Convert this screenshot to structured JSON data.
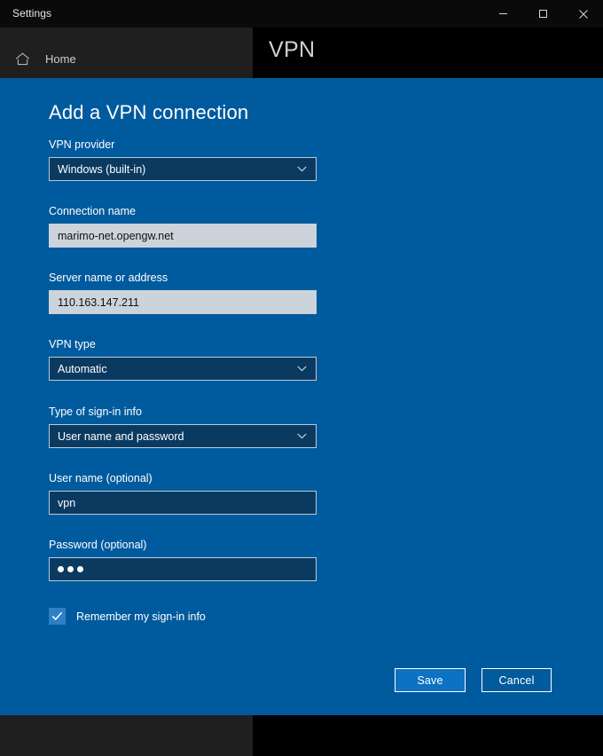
{
  "window": {
    "title": "Settings",
    "controls": [
      {
        "name": "minimize",
        "glyph": "minimize-icon"
      },
      {
        "name": "maximize",
        "glyph": "maximize-icon"
      },
      {
        "name": "close",
        "glyph": "close-icon"
      }
    ]
  },
  "sidebar": {
    "home_label": "Home",
    "home_icon": "home-icon"
  },
  "page": {
    "header": "VPN"
  },
  "dialog": {
    "title": "Add a VPN connection",
    "fields": [
      {
        "label": "VPN provider",
        "value": "Windows (built-in)",
        "type": "dropdown",
        "name": "vpn-provider"
      },
      {
        "label": "Connection name",
        "value": "marimo-net.opengw.net",
        "type": "text-filled",
        "name": "connection-name"
      },
      {
        "label": "Server name or address",
        "value": "110.163.147.211",
        "type": "text-filled",
        "name": "server-address"
      },
      {
        "label": "VPN type",
        "value": "Automatic",
        "type": "dropdown",
        "name": "vpn-type"
      },
      {
        "label": "Type of sign-in info",
        "value": "User name and password",
        "type": "dropdown",
        "name": "signin-type"
      },
      {
        "label": "User name (optional)",
        "value": "vpn",
        "type": "text-dark",
        "name": "user-name"
      },
      {
        "label": "Password (optional)",
        "value": "•••",
        "masked_count": 3,
        "type": "password",
        "name": "password"
      }
    ],
    "checkbox": {
      "label": "Remember my sign-in info",
      "checked": true
    },
    "buttons": {
      "save": "Save",
      "cancel": "Cancel"
    }
  },
  "colors": {
    "dialog_bg": "#005a9e",
    "accent_button": "#0b72c4",
    "text_input_bg": "#ccd3da",
    "dark_control_bg": "#0b3a61",
    "checkbox_fill": "#2f7fc4",
    "window_bg": "#000000",
    "sidebar_bg": "#1f1f1f"
  }
}
